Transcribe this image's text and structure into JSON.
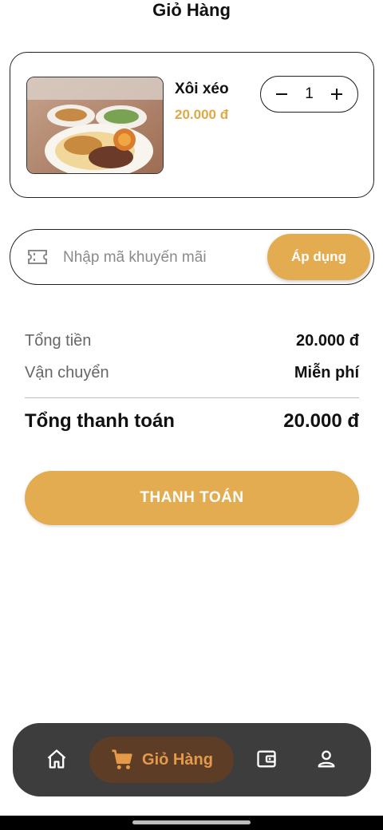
{
  "header": {
    "title": "Giỏ Hàng"
  },
  "cart": {
    "items": [
      {
        "name": "Xôi xéo",
        "price": "20.000 đ",
        "quantity": "1",
        "image_icon": "food-photo"
      }
    ]
  },
  "promo": {
    "placeholder": "Nhập mã khuyến mãi",
    "value": "",
    "apply_label": "Áp dụng",
    "icon": "ticket-icon"
  },
  "summary": {
    "subtotal_label": "Tổng tiền",
    "subtotal_value": "20.000 đ",
    "shipping_label": "Vận chuyển",
    "shipping_value": "Miễn phí",
    "total_label": "Tổng thanh toán",
    "total_value": "20.000 đ"
  },
  "checkout": {
    "label": "THANH TOÁN"
  },
  "bottom_nav": {
    "items": [
      {
        "icon": "home-icon",
        "label": ""
      },
      {
        "icon": "cart-icon",
        "label": "Giỏ Hàng",
        "active": true
      },
      {
        "icon": "wallet-icon",
        "label": ""
      },
      {
        "icon": "profile-icon",
        "label": ""
      }
    ]
  },
  "colors": {
    "accent": "#e3ac50",
    "price": "#e0a845",
    "nav_bg": "#3d3d3d",
    "nav_active_bg": "#5e3d26",
    "nav_active_fg": "#e59a4a"
  }
}
